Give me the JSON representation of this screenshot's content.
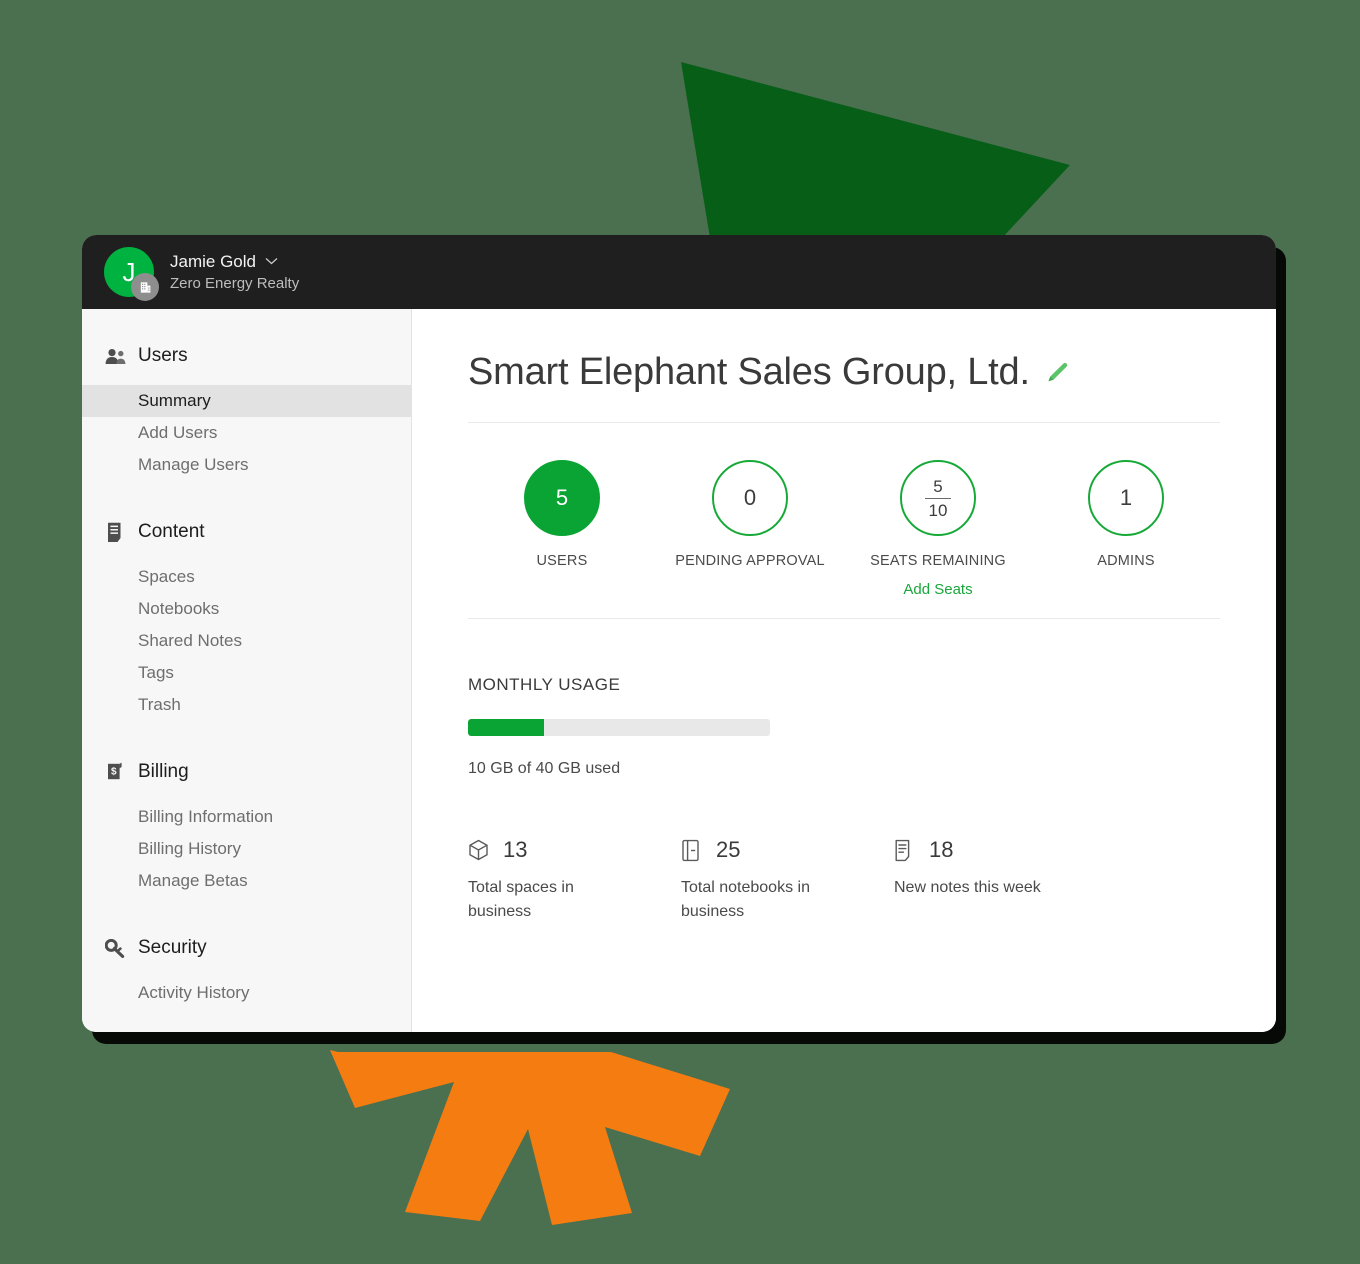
{
  "theme": {
    "page_background": "#4a7050",
    "accent_green": "#0aa434",
    "ring_green": "#17a938",
    "link_green": "#1aa63b",
    "deco_green": "#075e16",
    "deco_orange": "#f57c11",
    "topbar_dark": "#1f1f1f"
  },
  "decorations": {
    "green_arrow_label": "green-arrow-shape",
    "orange_burst_label": "orange-burst-shape"
  },
  "topbar": {
    "avatar_initial": "J",
    "avatar_badge_icon": "business-building-icon",
    "user_name": "Jamie Gold",
    "org_name": "Zero Energy Realty",
    "chevron_icon": "chevron-down-icon"
  },
  "sidebar": {
    "sections": [
      {
        "id": "users",
        "label": "Users",
        "icon": "people-icon",
        "items": [
          {
            "label": "Summary",
            "active": true
          },
          {
            "label": "Add Users",
            "active": false
          },
          {
            "label": "Manage Users",
            "active": false
          }
        ]
      },
      {
        "id": "content",
        "label": "Content",
        "icon": "document-icon",
        "items": [
          {
            "label": "Spaces",
            "active": false
          },
          {
            "label": "Notebooks",
            "active": false
          },
          {
            "label": "Shared Notes",
            "active": false
          },
          {
            "label": "Tags",
            "active": false
          },
          {
            "label": "Trash",
            "active": false
          }
        ]
      },
      {
        "id": "billing",
        "label": "Billing",
        "icon": "dollar-bill-icon",
        "items": [
          {
            "label": "Billing Information",
            "active": false
          },
          {
            "label": "Billing History",
            "active": false
          },
          {
            "label": "Manage Betas",
            "active": false
          }
        ]
      },
      {
        "id": "security",
        "label": "Security",
        "icon": "key-icon",
        "items": [
          {
            "label": "Activity History",
            "active": false
          }
        ]
      }
    ]
  },
  "main": {
    "page_title": "Smart Elephant Sales Group, Ltd.",
    "edit_icon": "pencil-edit-icon",
    "stats": [
      {
        "value": "5",
        "label": "USERS",
        "filled": true,
        "fraction": null,
        "link": null
      },
      {
        "value": "0",
        "label": "PENDING APPROVAL",
        "filled": false,
        "fraction": null,
        "link": null
      },
      {
        "value": null,
        "label": "SEATS REMAINING",
        "filled": false,
        "fraction": {
          "numerator": "5",
          "denominator": "10"
        },
        "link": "Add Seats"
      },
      {
        "value": "1",
        "label": "ADMINS",
        "filled": false,
        "fraction": null,
        "link": null
      }
    ],
    "usage": {
      "heading": "MONTHLY USAGE",
      "percent": 25,
      "caption": "10 GB of 40 GB used"
    },
    "metrics": [
      {
        "icon": "cube-icon",
        "value": "13",
        "label": "Total spaces in business"
      },
      {
        "icon": "notebook-icon",
        "value": "25",
        "label": "Total notebooks in business"
      },
      {
        "icon": "note-icon",
        "value": "18",
        "label": "New notes this week"
      }
    ]
  }
}
